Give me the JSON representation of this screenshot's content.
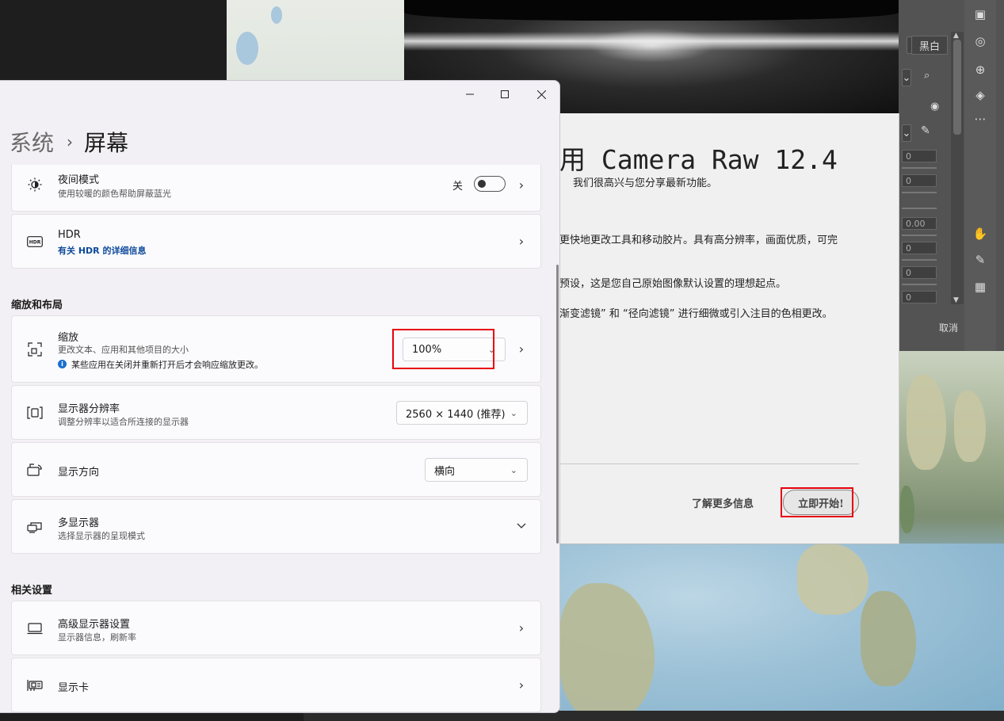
{
  "settings": {
    "breadcrumb": {
      "parent": "系统",
      "separator": "›",
      "current": "屏幕"
    },
    "window_controls": {
      "minimize": "—",
      "maximize": "☐",
      "close": "✕"
    },
    "night_light": {
      "title": "夜间模式",
      "desc": "使用较暖的颜色帮助屏蔽蓝光",
      "toggle_label": "关",
      "toggle_on": false
    },
    "hdr": {
      "title": "HDR",
      "link": "有关 HDR 的详细信息"
    },
    "section_scale": "缩放和布局",
    "scale": {
      "title": "缩放",
      "desc": "更改文本、应用和其他项目的大小",
      "note": "某些应用在关闭并重新打开后才会响应缩放更改。",
      "value": "100%"
    },
    "resolution": {
      "title": "显示器分辨率",
      "desc": "调整分辨率以适合所连接的显示器",
      "value": "2560 × 1440 (推荐)"
    },
    "orientation": {
      "title": "显示方向",
      "value": "横向"
    },
    "multi_display": {
      "title": "多显示器",
      "desc": "选择显示器的呈现模式"
    },
    "section_related": "相关设置",
    "advanced": {
      "title": "高级显示器设置",
      "desc": "显示器信息，刷新率"
    },
    "gpu": {
      "title": "显示卡"
    }
  },
  "camera_raw": {
    "title": "用 Camera Raw 12.4",
    "subtitle": "我们很高兴与您分享最新功能。",
    "lines": [
      "更快地更改工具和移动胶片。具有高分辨率，画面优质，可完",
      "预设，这是您自己原始图像默认设置的理想起点。",
      "渐变滤镜” 和 “径向滤镜” 进行细微或引入注目的色相更改。"
    ],
    "learn_more": "了解更多信息",
    "start": "立即开始!"
  },
  "photoshop": {
    "bw_button": "黑白",
    "inputs": [
      "0",
      "0",
      "0.00",
      "0",
      "0",
      "0"
    ],
    "cancel": "取消"
  },
  "colors": {
    "highlight": "#e8000b",
    "link": "#0e4a9a",
    "info": "#1a6fd0"
  }
}
